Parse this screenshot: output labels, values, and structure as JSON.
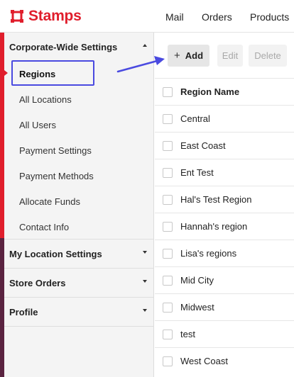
{
  "app": {
    "brand": "Stamps",
    "brand_color": "#e01e2c"
  },
  "nav": {
    "mail": "Mail",
    "orders": "Orders",
    "products": "Products"
  },
  "sidebar": {
    "corporate": {
      "title": "Corporate-Wide Settings",
      "items": [
        {
          "label": "Regions",
          "active": true
        },
        {
          "label": "All Locations"
        },
        {
          "label": "All Users"
        },
        {
          "label": "Payment Settings"
        },
        {
          "label": "Payment Methods"
        },
        {
          "label": "Allocate Funds"
        },
        {
          "label": "Contact Info"
        }
      ]
    },
    "my_location": "My Location Settings",
    "store_orders": "Store Orders",
    "profile": "Profile"
  },
  "toolbar": {
    "add_label": "Add",
    "add_icon": "+",
    "edit_label": "Edit",
    "delete_label": "Delete"
  },
  "table": {
    "header": "Region Name",
    "rows": [
      "Central",
      "East Coast",
      "Ent Test",
      "Hal's Test Region",
      "Hannah's region",
      "Lisa's regions",
      "Mid City",
      "Midwest",
      "test",
      "West Coast"
    ]
  },
  "annotation": {
    "color": "#4a4ae0"
  }
}
